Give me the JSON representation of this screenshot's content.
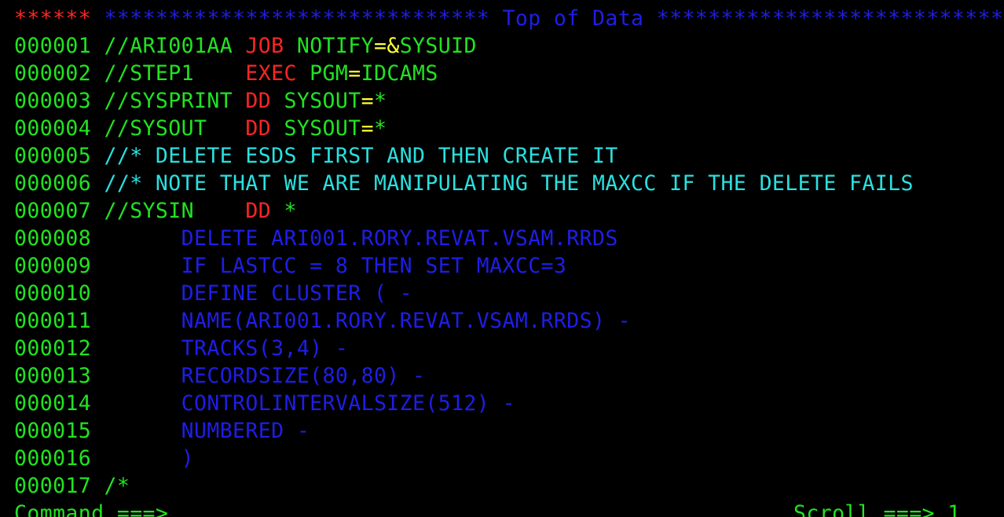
{
  "header": {
    "marker_left": "******",
    "marker_right": "******************************",
    "title": "Top of Data",
    "marker_trail": "*****************************"
  },
  "lines": [
    {
      "num": "000001",
      "parts": [
        {
          "text": "//ARI001AA ",
          "color": "g"
        },
        {
          "text": "JOB",
          "color": "r"
        },
        {
          "text": " NOTIFY",
          "color": "g"
        },
        {
          "text": "=",
          "color": "y"
        },
        {
          "text": "&",
          "color": "y"
        },
        {
          "text": "SYSUID",
          "color": "g"
        }
      ]
    },
    {
      "num": "000002",
      "parts": [
        {
          "text": "//STEP1    ",
          "color": "g"
        },
        {
          "text": "EXEC",
          "color": "r"
        },
        {
          "text": " PGM",
          "color": "g"
        },
        {
          "text": "=",
          "color": "y"
        },
        {
          "text": "IDCAMS",
          "color": "g"
        }
      ]
    },
    {
      "num": "000003",
      "parts": [
        {
          "text": "//SYSPRINT ",
          "color": "g"
        },
        {
          "text": "DD",
          "color": "r"
        },
        {
          "text": " SYSOUT",
          "color": "g"
        },
        {
          "text": "=",
          "color": "y"
        },
        {
          "text": "*",
          "color": "g"
        }
      ]
    },
    {
      "num": "000004",
      "parts": [
        {
          "text": "//SYSOUT   ",
          "color": "g"
        },
        {
          "text": "DD",
          "color": "r"
        },
        {
          "text": " SYSOUT",
          "color": "g"
        },
        {
          "text": "=",
          "color": "y"
        },
        {
          "text": "*",
          "color": "g"
        }
      ]
    },
    {
      "num": "000005",
      "parts": [
        {
          "text": "//* DELETE ESDS FIRST AND THEN CREATE IT",
          "color": "c"
        }
      ]
    },
    {
      "num": "000006",
      "parts": [
        {
          "text": "//* NOTE THAT WE ARE MANIPULATING THE MAXCC IF THE DELETE FAILS",
          "color": "c"
        }
      ]
    },
    {
      "num": "000007",
      "parts": [
        {
          "text": "//SYSIN    ",
          "color": "g"
        },
        {
          "text": "DD",
          "color": "r"
        },
        {
          "text": " *",
          "color": "g"
        }
      ]
    },
    {
      "num": "000008",
      "parts": [
        {
          "text": "      DELETE ARI001.RORY.REVAT.VSAM.RRDS",
          "color": "b"
        }
      ]
    },
    {
      "num": "000009",
      "parts": [
        {
          "text": "      IF LASTCC = 8 THEN SET MAXCC=3",
          "color": "b"
        }
      ]
    },
    {
      "num": "000010",
      "parts": [
        {
          "text": "      DEFINE CLUSTER ( -",
          "color": "b"
        }
      ]
    },
    {
      "num": "000011",
      "parts": [
        {
          "text": "      NAME(ARI001.RORY.REVAT.VSAM.RRDS) -",
          "color": "b"
        }
      ]
    },
    {
      "num": "000012",
      "parts": [
        {
          "text": "      TRACKS(3,4) -",
          "color": "b"
        }
      ]
    },
    {
      "num": "000013",
      "parts": [
        {
          "text": "      RECORDSIZE(80,80) -",
          "color": "b"
        }
      ]
    },
    {
      "num": "000014",
      "parts": [
        {
          "text": "      CONTROLINTERVALSIZE(512) -",
          "color": "b"
        }
      ]
    },
    {
      "num": "000015",
      "parts": [
        {
          "text": "      NUMBERED -",
          "color": "b"
        }
      ]
    },
    {
      "num": "000016",
      "parts": [
        {
          "text": "      )",
          "color": "b"
        }
      ]
    },
    {
      "num": "000017",
      "parts": [
        {
          "text": "/*",
          "color": "g"
        }
      ]
    }
  ],
  "command": {
    "label": "Command ===>",
    "value": ""
  },
  "scroll": {
    "label": "Scroll ===>",
    "value": "1"
  },
  "colors": {
    "background": "#000000",
    "green": "#21e321",
    "red": "#ff2424",
    "blue": "#1e1ee8",
    "cyan": "#2ae0e0",
    "yellow": "#ffff33"
  }
}
